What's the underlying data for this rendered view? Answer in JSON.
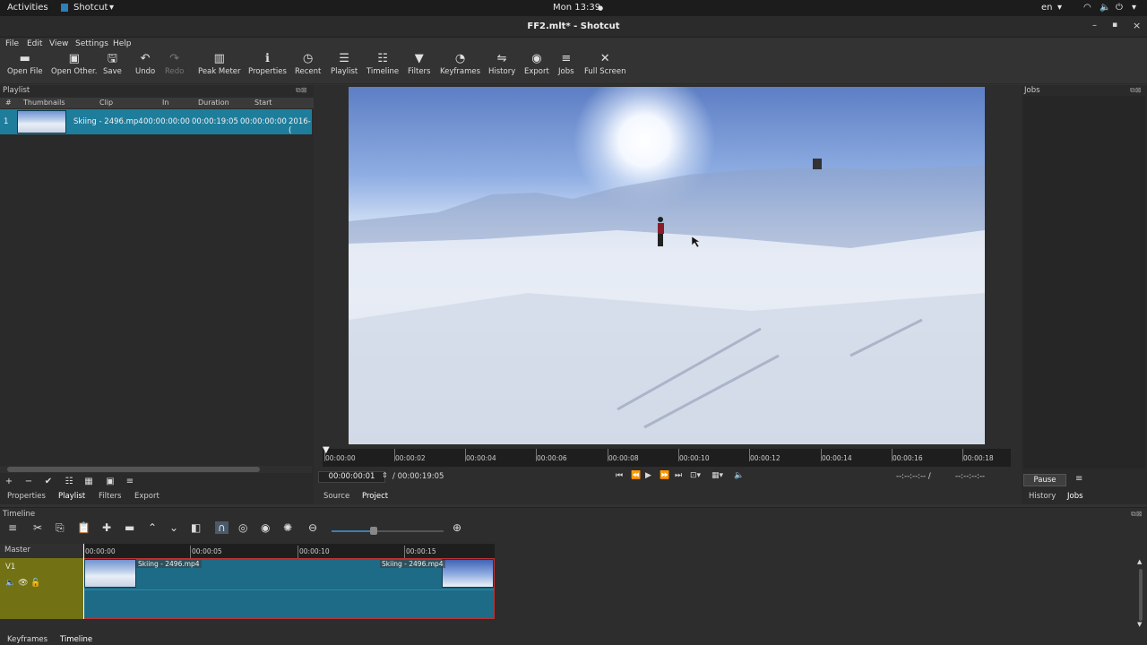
{
  "system": {
    "activities": "Activities",
    "app": "Shotcut",
    "clock": "Mon 13:39",
    "lang": "en"
  },
  "window": {
    "title": "FF2.mlt* - Shotcut"
  },
  "menu": [
    "File",
    "Edit",
    "View",
    "Settings",
    "Help"
  ],
  "toolbar": [
    {
      "label": "Open File",
      "icon": "▬"
    },
    {
      "label": "Open Other.",
      "icon": "▣"
    },
    {
      "label": "Save",
      "icon": "🖫"
    },
    {
      "label": "Undo",
      "icon": "↶"
    },
    {
      "label": "Redo",
      "icon": "↷"
    },
    {
      "label": "Peak Meter",
      "icon": "▥"
    },
    {
      "label": "Properties",
      "icon": "ℹ"
    },
    {
      "label": "Recent",
      "icon": "◷"
    },
    {
      "label": "Playlist",
      "icon": "☰"
    },
    {
      "label": "Timeline",
      "icon": "☷"
    },
    {
      "label": "Filters",
      "icon": "▼"
    },
    {
      "label": "Keyframes",
      "icon": "◔"
    },
    {
      "label": "History",
      "icon": "⇋"
    },
    {
      "label": "Export",
      "icon": "◉"
    },
    {
      "label": "Jobs",
      "icon": "≡"
    },
    {
      "label": "Full Screen",
      "icon": "✕"
    }
  ],
  "playlist": {
    "title": "Playlist",
    "columns": [
      "#",
      "Thumbnails",
      "Clip",
      "In",
      "Duration",
      "Start"
    ],
    "rows": [
      {
        "num": "1",
        "clip": "Skiing - 2496.mp4",
        "in": "00:00:00:00",
        "duration": "00:00:19:05",
        "start": "00:00:00:00",
        "date": "2016-("
      }
    ],
    "tabs": [
      "Properties",
      "Playlist",
      "Filters",
      "Export"
    ]
  },
  "viewer": {
    "ruler": [
      "00:00:00",
      "00:00:02",
      "00:00:04",
      "00:00:06",
      "00:00:08",
      "00:00:10",
      "00:00:12",
      "00:00:14",
      "00:00:16",
      "00:00:18"
    ],
    "position": "00:00:00:01",
    "duration": "/ 00:00:19:05",
    "in_out": "--:--:--:-- /",
    "in_out2": "--:--:--:--",
    "tabs": [
      "Source",
      "Project"
    ]
  },
  "jobs": {
    "title": "Jobs",
    "pause": "Pause",
    "tabs": [
      "History",
      "Jobs"
    ]
  },
  "timeline": {
    "title": "Timeline",
    "master": "Master",
    "track": "V1",
    "ruler": [
      "00:00:00",
      "00:00:05",
      "00:00:10",
      "00:00:15"
    ],
    "clip_label": "Skiing - 2496.mp4",
    "tabs": [
      "Keyframes",
      "Timeline"
    ]
  }
}
